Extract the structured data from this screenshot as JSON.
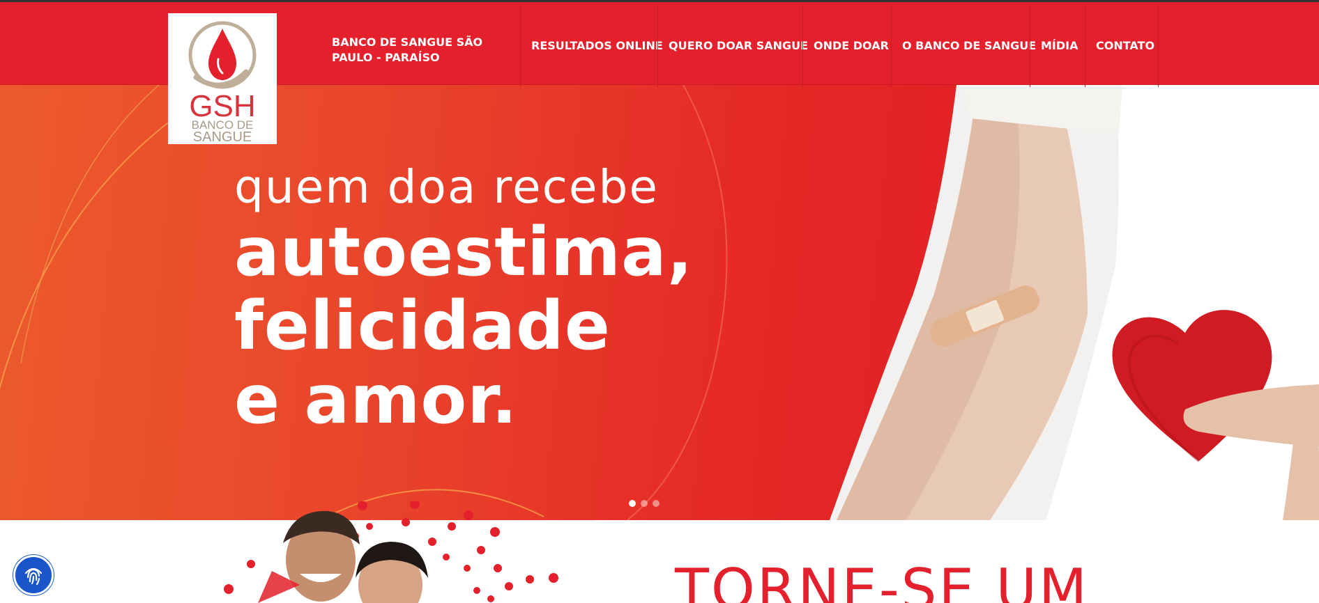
{
  "header": {
    "site_name_line1": "BANCO DE SANGUE SÃO",
    "site_name_line2": "PAULO - PARAÍSO",
    "logo_text_main": "GSH",
    "logo_text_sub1": "BANCO DE",
    "logo_text_sub2": "SANGUE",
    "nav": [
      {
        "label": "RESULTADOS ONLINE"
      },
      {
        "label": "QUERO DOAR SANGUE"
      },
      {
        "label": "ONDE DOAR"
      },
      {
        "label": "O BANCO DE SANGUE"
      },
      {
        "label": "MÍDIA"
      },
      {
        "label": "CONTATO"
      }
    ]
  },
  "hero": {
    "line1": "quem doa recebe",
    "line2": "autoestima,",
    "line3": "felicidade",
    "line4": "e amor.",
    "slides_total": 3,
    "active_slide": 1
  },
  "section": {
    "heading": "TORNE-SE UM"
  },
  "icons": {
    "accessibility": "fingerprint-icon",
    "logo": "blood-drop-icon"
  },
  "colors": {
    "brand_red": "#e3202b",
    "hero_orange": "#ec5a2d",
    "accessibility_blue": "#1a56c9"
  }
}
